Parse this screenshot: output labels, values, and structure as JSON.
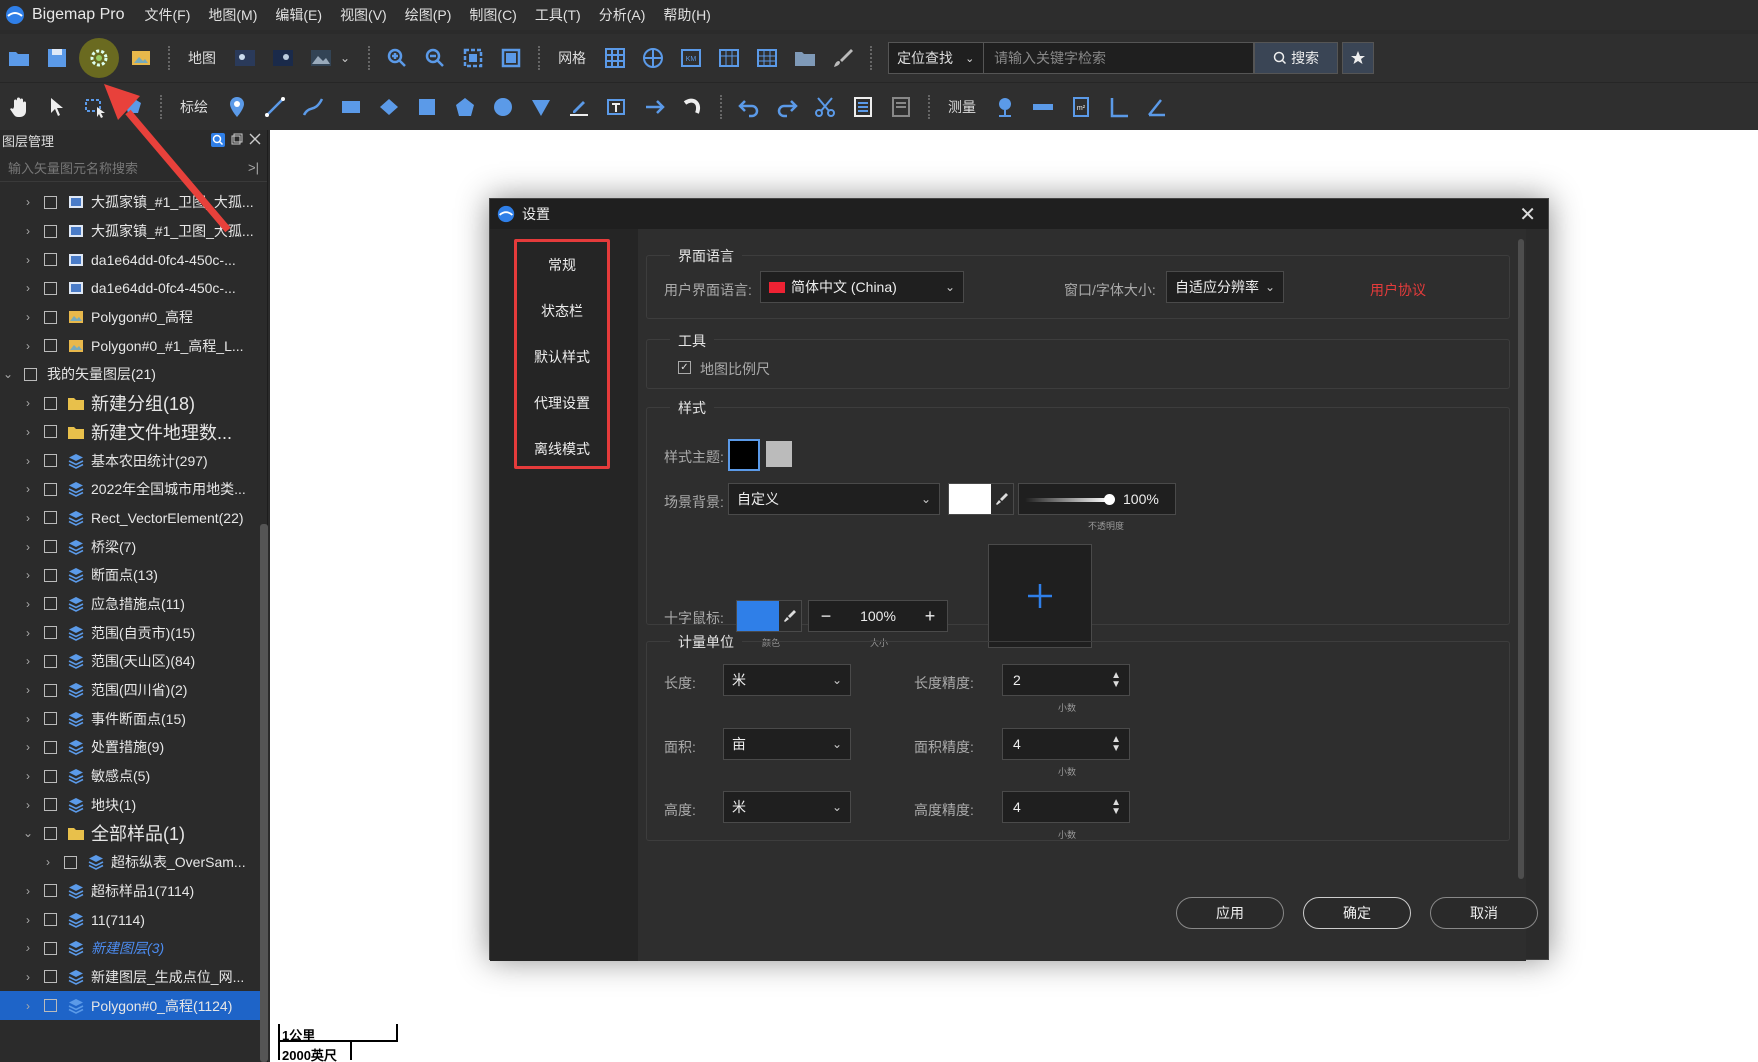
{
  "app": {
    "title": "Bigemap Pro"
  },
  "menu": [
    "文件(F)",
    "地图(M)",
    "编辑(E)",
    "视图(V)",
    "绘图(P)",
    "制图(C)",
    "工具(T)",
    "分析(A)",
    "帮助(H)"
  ],
  "toolbar1": {
    "map_label": "地图",
    "grid_label": "网格",
    "search_mode": "定位查找",
    "search_placeholder": "请输入关键字检索",
    "search_button": "搜索"
  },
  "toolbar2": {
    "draw_label": "标绘",
    "measure_label": "测量"
  },
  "layer_panel": {
    "title": "图层管理",
    "search_placeholder": "输入矢量图元名称搜索",
    "rows": [
      {
        "label": "大孤家镇_#1_卫图_大孤...",
        "icon": "raster-icon",
        "indent": 1
      },
      {
        "label": "大孤家镇_#1_卫图_大孤...",
        "icon": "raster-icon",
        "indent": 1
      },
      {
        "label": "da1e64dd-0fc4-450c-...",
        "icon": "raster-icon",
        "indent": 1
      },
      {
        "label": "da1e64dd-0fc4-450c-...",
        "icon": "raster-icon",
        "indent": 1
      },
      {
        "label": "Polygon#0_高程",
        "icon": "elevation-icon",
        "indent": 1
      },
      {
        "label": "Polygon#0_#1_高程_L...",
        "icon": "elevation-icon",
        "indent": 1
      },
      {
        "label": "我的矢量图层(21)",
        "icon": "",
        "indent": 0,
        "expanded": true
      },
      {
        "label": "新建分组(18)",
        "icon": "folder-icon",
        "indent": 1,
        "big": true
      },
      {
        "label": "新建文件地理数...",
        "icon": "folder-icon",
        "indent": 1,
        "big": true
      },
      {
        "label": "基本农田统计(297)",
        "icon": "layers-icon",
        "indent": 1
      },
      {
        "label": "2022年全国城市用地类...",
        "icon": "layers-icon",
        "indent": 1
      },
      {
        "label": "Rect_VectorElement(22)",
        "icon": "layers-icon",
        "indent": 1
      },
      {
        "label": "桥梁(7)",
        "icon": "layers-icon",
        "indent": 1
      },
      {
        "label": "断面点(13)",
        "icon": "layers-icon",
        "indent": 1
      },
      {
        "label": "应急措施点(11)",
        "icon": "layers-icon",
        "indent": 1
      },
      {
        "label": "范围(自贡市)(15)",
        "icon": "layers-icon",
        "indent": 1
      },
      {
        "label": "范围(天山区)(84)",
        "icon": "layers-icon",
        "indent": 1
      },
      {
        "label": "范围(四川省)(2)",
        "icon": "layers-icon",
        "indent": 1
      },
      {
        "label": "事件断面点(15)",
        "icon": "layers-icon",
        "indent": 1
      },
      {
        "label": "处置措施(9)",
        "icon": "layers-icon",
        "indent": 1
      },
      {
        "label": "敏感点(5)",
        "icon": "layers-icon",
        "indent": 1
      },
      {
        "label": "地块(1)",
        "icon": "layers-icon",
        "indent": 1
      },
      {
        "label": "全部样品(1)",
        "icon": "folder-icon",
        "indent": 1,
        "big": true,
        "expanded": true
      },
      {
        "label": "超标纵表_OverSam...",
        "icon": "layers-icon",
        "indent": 2
      },
      {
        "label": "超标样品1(7114)",
        "icon": "layers-icon",
        "indent": 1
      },
      {
        "label": "11(7114)",
        "icon": "layers-icon",
        "indent": 1
      },
      {
        "label": "新建图层(3)",
        "icon": "layers-icon",
        "indent": 1,
        "italic": true
      },
      {
        "label": "新建图层_生成点位_网...",
        "icon": "layers-icon",
        "indent": 1
      },
      {
        "label": "Polygon#0_高程(1124)",
        "icon": "layers-icon",
        "indent": 1,
        "selected": true
      }
    ]
  },
  "scale_bar": {
    "km": "1公里",
    "ft": "2000英尺"
  },
  "dialog": {
    "title": "设置",
    "nav": [
      "常规",
      "状态栏",
      "默认样式",
      "代理设置",
      "离线模式"
    ],
    "language_section": "界面语言",
    "ui_language_label": "用户界面语言:",
    "ui_language_value": "简体中文 (China)",
    "font_size_label": "窗口/字体大小:",
    "font_size_value": "自适应分辨率",
    "user_agreement": "用户协议",
    "tools_section": "工具",
    "scale_checkbox": "地图比例尺",
    "style_section": "样式",
    "theme_label": "样式主题:",
    "scene_bg_label": "场景背景:",
    "scene_bg_value": "自定义",
    "opacity_value": "100%",
    "opacity_fraction": 1.0,
    "opacity_caption": "不透明度",
    "cursor_label": "十字鼠标:",
    "cursor_color_caption": "颜色",
    "cursor_size_value": "100%",
    "cursor_size_caption": "大小",
    "units_section": "计量单位",
    "length_label": "长度:",
    "length_value": "米",
    "length_precision_label": "长度精度:",
    "length_precision_value": "2",
    "area_label": "面积:",
    "area_value": "亩",
    "area_precision_label": "面积精度:",
    "area_precision_value": "4",
    "height_label": "高度:",
    "height_value": "米",
    "height_precision_label": "高度精度:",
    "height_precision_value": "4",
    "decimal_caption": "小数",
    "apply": "应用",
    "ok": "确定",
    "cancel": "取消"
  },
  "colors": {
    "accent": "#1e64c8",
    "highlight": "#e53b3b",
    "cursor_color": "#2f7fe8"
  }
}
